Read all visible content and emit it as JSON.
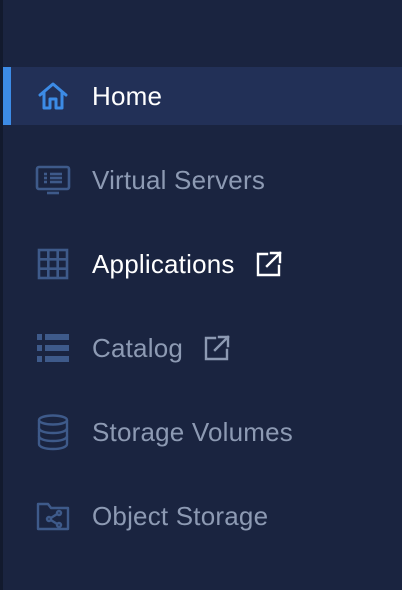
{
  "nav": {
    "items": [
      {
        "label": "Home",
        "icon": "home-icon",
        "active": true
      },
      {
        "label": "Virtual Servers",
        "icon": "monitor-icon"
      },
      {
        "label": "Applications",
        "icon": "grid-icon",
        "external": true
      },
      {
        "label": "Catalog",
        "icon": "list-icon",
        "external": true
      },
      {
        "label": "Storage Volumes",
        "icon": "database-icon"
      },
      {
        "label": "Object Storage",
        "icon": "share-folder-icon"
      }
    ]
  },
  "colors": {
    "background": "#1a2440",
    "active_background": "#223057",
    "active_accent": "#3c8be6",
    "icon_muted": "#3e5a8a",
    "text_muted": "#8d9ab3",
    "text_active": "#ffffff"
  }
}
